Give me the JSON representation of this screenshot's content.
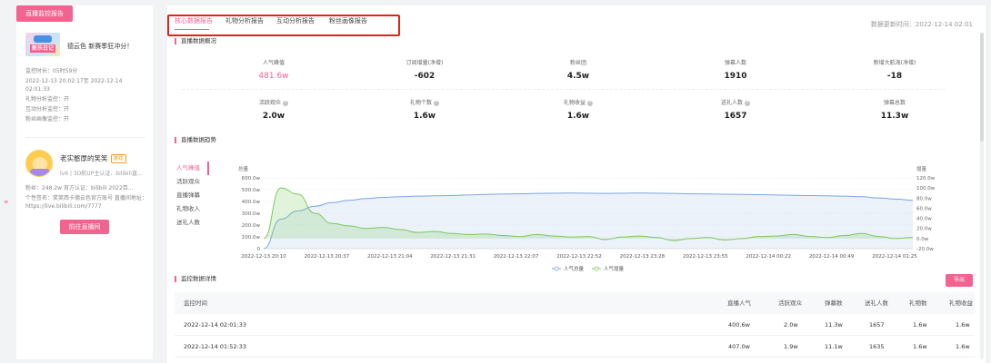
{
  "left": {
    "tab_label": "直播监控报告",
    "expand_glyph": "»",
    "card1": {
      "thumb_text": "新乐日记",
      "title": "德云色 新赛季狂冲分！",
      "meta": [
        "监控时长：05时59分",
        "2022-12-13 20:02:17至 2022-12-14 02:01:33",
        "礼物分析监控：开",
        "互动分析监控：开",
        "粉丝画像监控：开"
      ]
    },
    "card2": {
      "name": "老实憨厚的笑笑",
      "badge": "游戏",
      "sub": "lv6 | 3D航UP主认证、bilibili直...",
      "meta": [
        "粉丝：248.2w       官方认证：bilibili 2022百...",
        "个性签名：笑笑西卡德云色官方账号 直播间地址：",
        "https://live.bilibili.com/7777"
      ],
      "button": "前往直播间"
    }
  },
  "tabs": [
    "核心数据报告",
    "礼物分析报告",
    "互动分析报告",
    "粉丝画像报告"
  ],
  "update_time": "数据更新时间：2022-12-14 02:01",
  "overview": {
    "title": "直播数据概况",
    "row1": [
      {
        "label": "人气峰值",
        "value": "481.6w",
        "q": false
      },
      {
        "label": "订阅增量(净增)",
        "value": "-602",
        "q": false
      },
      {
        "label": "粉丝团",
        "value": "4.5w",
        "q": false
      },
      {
        "label": "弹幕人数",
        "value": "1910",
        "q": false
      },
      {
        "label": "新增大航海(净增)",
        "value": "-18",
        "q": false
      }
    ],
    "row2": [
      {
        "label": "活跃观众",
        "value": "2.0w",
        "q": true
      },
      {
        "label": "礼物个数",
        "value": "1.6w",
        "q": true
      },
      {
        "label": "礼物收益",
        "value": "1.6w",
        "q": true
      },
      {
        "label": "送礼人数",
        "value": "1657",
        "q": true
      },
      {
        "label": "弹幕总数",
        "value": "11.3w",
        "q": false
      }
    ],
    "q_glyph": "?"
  },
  "trend": {
    "title": "直播数据趋势",
    "menu": [
      "人气峰值",
      "活跃观众",
      "直播弹幕",
      "礼物收入",
      "送礼人数"
    ],
    "active": 0
  },
  "chart_data": {
    "type": "line",
    "left_axis_label": "总量",
    "right_axis_label": "增量",
    "left_ticks": [
      "600.0w",
      "500.0w",
      "400.0w",
      "300.0w",
      "200.0w",
      "100.0w",
      "0"
    ],
    "right_ticks": [
      "120.0w",
      "100.0w",
      "80.0w",
      "60.0w",
      "40.0w",
      "20.0w",
      "0.0w",
      "-20.0w"
    ],
    "ylim_left": [
      0,
      600
    ],
    "ylim_right": [
      -20,
      120
    ],
    "x_labels": [
      "2022-12-13 20:10",
      "2022-12-13 20:37",
      "2022-12-13 21:04",
      "2022-12-13 21:31",
      "2022-12-13 22:07",
      "2022-12-13 22:52",
      "2022-12-13 23:28",
      "2022-12-13 23:55",
      "2022-12-14 00:22",
      "2022-12-14 00:49",
      "2022-12-14 01:25"
    ],
    "series": [
      {
        "name": "人气总量",
        "axis": "left",
        "color": "#7aa7e0",
        "values": [
          0,
          250,
          320,
          360,
          390,
          410,
          425,
          435,
          440,
          445,
          448,
          450,
          455,
          460,
          463,
          465,
          468,
          470,
          472,
          470,
          468,
          470,
          472,
          470,
          468,
          465,
          463,
          462,
          460,
          458,
          455,
          452,
          450,
          448,
          445,
          440,
          430,
          420,
          410
        ]
      },
      {
        "name": "人气增量",
        "axis": "right",
        "color": "#7cc85e",
        "values": [
          0,
          100,
          88,
          50,
          30,
          25,
          20,
          22,
          18,
          12,
          14,
          10,
          8,
          9,
          6,
          4,
          8,
          5,
          3,
          4,
          -2,
          3,
          5,
          2,
          -4,
          0,
          2,
          -3,
          0,
          4,
          5,
          8,
          4,
          2,
          6,
          10,
          4,
          0,
          2
        ]
      }
    ],
    "legend": [
      "人气总量",
      "人气增量"
    ]
  },
  "detail": {
    "title": "监控数据详情",
    "export": "导出",
    "columns": [
      "监控时间",
      "直播人气",
      "活跃观众",
      "弹幕数",
      "送礼人数",
      "礼物数",
      "礼物收益"
    ],
    "rows": [
      [
        "2022-12-14 02:01:33",
        "400.6w",
        "2.0w",
        "11.3w",
        "1657",
        "1.6w",
        "1.6w"
      ],
      [
        "2022-12-14 01:52:33",
        "407.0w",
        "1.9w",
        "11.1w",
        "1635",
        "1.6w",
        "1.6w"
      ]
    ]
  }
}
